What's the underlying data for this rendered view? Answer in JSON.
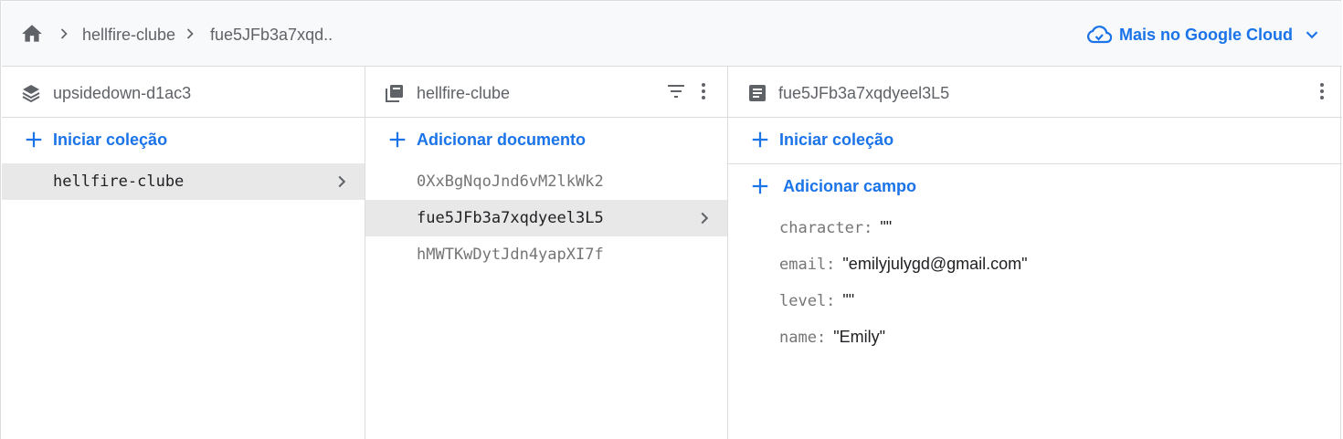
{
  "breadcrumb": {
    "items": [
      "hellfire-clube",
      "fue5JFb3a7xqd.."
    ],
    "cloud_label": "Mais no Google Cloud"
  },
  "columns": {
    "root": {
      "title": "upsidedown-d1ac3",
      "action": "Iniciar coleção",
      "items": [
        "hellfire-clube"
      ]
    },
    "collection": {
      "title": "hellfire-clube",
      "action": "Adicionar documento",
      "items": [
        "0XxBgNqoJnd6vM2lkWk2",
        "fue5JFb3a7xqdyeel3L5",
        "hMWTKwDytJdn4yapXI7f"
      ]
    },
    "document": {
      "title": "fue5JFb3a7xqdyeel3L5",
      "action_collection": "Iniciar coleção",
      "action_field": "Adicionar campo",
      "fields": [
        {
          "key": "character:",
          "value": "\"\""
        },
        {
          "key": "email:",
          "value": "\"emilyjulygd@gmail.com\""
        },
        {
          "key": "level:",
          "value": "\"\""
        },
        {
          "key": "name:",
          "value": "\"Emily\""
        }
      ]
    }
  },
  "colors": {
    "accent": "#1a73e8",
    "selected_row": "#e8e8e8",
    "border": "#dadce0"
  },
  "icons": [
    "home-icon",
    "chevron-right-icon",
    "cloud-icon",
    "chevron-down-icon",
    "database-icon",
    "collection-icon",
    "filter-icon",
    "more-vert-icon",
    "document-icon",
    "plus-icon"
  ]
}
